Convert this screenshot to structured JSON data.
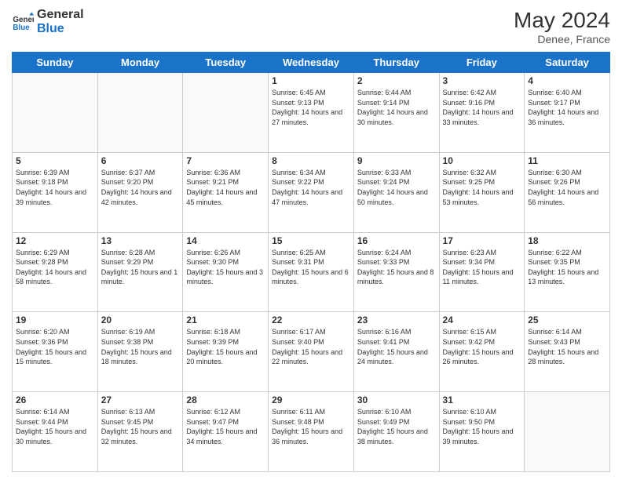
{
  "header": {
    "logo_general": "General",
    "logo_blue": "Blue",
    "month_year": "May 2024",
    "location": "Denee, France"
  },
  "days_of_week": [
    "Sunday",
    "Monday",
    "Tuesday",
    "Wednesday",
    "Thursday",
    "Friday",
    "Saturday"
  ],
  "weeks": [
    [
      {
        "day": "",
        "info": ""
      },
      {
        "day": "",
        "info": ""
      },
      {
        "day": "",
        "info": ""
      },
      {
        "day": "1",
        "info": "Sunrise: 6:45 AM\nSunset: 9:13 PM\nDaylight: 14 hours and 27 minutes."
      },
      {
        "day": "2",
        "info": "Sunrise: 6:44 AM\nSunset: 9:14 PM\nDaylight: 14 hours and 30 minutes."
      },
      {
        "day": "3",
        "info": "Sunrise: 6:42 AM\nSunset: 9:16 PM\nDaylight: 14 hours and 33 minutes."
      },
      {
        "day": "4",
        "info": "Sunrise: 6:40 AM\nSunset: 9:17 PM\nDaylight: 14 hours and 36 minutes."
      }
    ],
    [
      {
        "day": "5",
        "info": "Sunrise: 6:39 AM\nSunset: 9:18 PM\nDaylight: 14 hours and 39 minutes."
      },
      {
        "day": "6",
        "info": "Sunrise: 6:37 AM\nSunset: 9:20 PM\nDaylight: 14 hours and 42 minutes."
      },
      {
        "day": "7",
        "info": "Sunrise: 6:36 AM\nSunset: 9:21 PM\nDaylight: 14 hours and 45 minutes."
      },
      {
        "day": "8",
        "info": "Sunrise: 6:34 AM\nSunset: 9:22 PM\nDaylight: 14 hours and 47 minutes."
      },
      {
        "day": "9",
        "info": "Sunrise: 6:33 AM\nSunset: 9:24 PM\nDaylight: 14 hours and 50 minutes."
      },
      {
        "day": "10",
        "info": "Sunrise: 6:32 AM\nSunset: 9:25 PM\nDaylight: 14 hours and 53 minutes."
      },
      {
        "day": "11",
        "info": "Sunrise: 6:30 AM\nSunset: 9:26 PM\nDaylight: 14 hours and 56 minutes."
      }
    ],
    [
      {
        "day": "12",
        "info": "Sunrise: 6:29 AM\nSunset: 9:28 PM\nDaylight: 14 hours and 58 minutes."
      },
      {
        "day": "13",
        "info": "Sunrise: 6:28 AM\nSunset: 9:29 PM\nDaylight: 15 hours and 1 minute."
      },
      {
        "day": "14",
        "info": "Sunrise: 6:26 AM\nSunset: 9:30 PM\nDaylight: 15 hours and 3 minutes."
      },
      {
        "day": "15",
        "info": "Sunrise: 6:25 AM\nSunset: 9:31 PM\nDaylight: 15 hours and 6 minutes."
      },
      {
        "day": "16",
        "info": "Sunrise: 6:24 AM\nSunset: 9:33 PM\nDaylight: 15 hours and 8 minutes."
      },
      {
        "day": "17",
        "info": "Sunrise: 6:23 AM\nSunset: 9:34 PM\nDaylight: 15 hours and 11 minutes."
      },
      {
        "day": "18",
        "info": "Sunrise: 6:22 AM\nSunset: 9:35 PM\nDaylight: 15 hours and 13 minutes."
      }
    ],
    [
      {
        "day": "19",
        "info": "Sunrise: 6:20 AM\nSunset: 9:36 PM\nDaylight: 15 hours and 15 minutes."
      },
      {
        "day": "20",
        "info": "Sunrise: 6:19 AM\nSunset: 9:38 PM\nDaylight: 15 hours and 18 minutes."
      },
      {
        "day": "21",
        "info": "Sunrise: 6:18 AM\nSunset: 9:39 PM\nDaylight: 15 hours and 20 minutes."
      },
      {
        "day": "22",
        "info": "Sunrise: 6:17 AM\nSunset: 9:40 PM\nDaylight: 15 hours and 22 minutes."
      },
      {
        "day": "23",
        "info": "Sunrise: 6:16 AM\nSunset: 9:41 PM\nDaylight: 15 hours and 24 minutes."
      },
      {
        "day": "24",
        "info": "Sunrise: 6:15 AM\nSunset: 9:42 PM\nDaylight: 15 hours and 26 minutes."
      },
      {
        "day": "25",
        "info": "Sunrise: 6:14 AM\nSunset: 9:43 PM\nDaylight: 15 hours and 28 minutes."
      }
    ],
    [
      {
        "day": "26",
        "info": "Sunrise: 6:14 AM\nSunset: 9:44 PM\nDaylight: 15 hours and 30 minutes."
      },
      {
        "day": "27",
        "info": "Sunrise: 6:13 AM\nSunset: 9:45 PM\nDaylight: 15 hours and 32 minutes."
      },
      {
        "day": "28",
        "info": "Sunrise: 6:12 AM\nSunset: 9:47 PM\nDaylight: 15 hours and 34 minutes."
      },
      {
        "day": "29",
        "info": "Sunrise: 6:11 AM\nSunset: 9:48 PM\nDaylight: 15 hours and 36 minutes."
      },
      {
        "day": "30",
        "info": "Sunrise: 6:10 AM\nSunset: 9:49 PM\nDaylight: 15 hours and 38 minutes."
      },
      {
        "day": "31",
        "info": "Sunrise: 6:10 AM\nSunset: 9:50 PM\nDaylight: 15 hours and 39 minutes."
      },
      {
        "day": "",
        "info": ""
      }
    ]
  ]
}
